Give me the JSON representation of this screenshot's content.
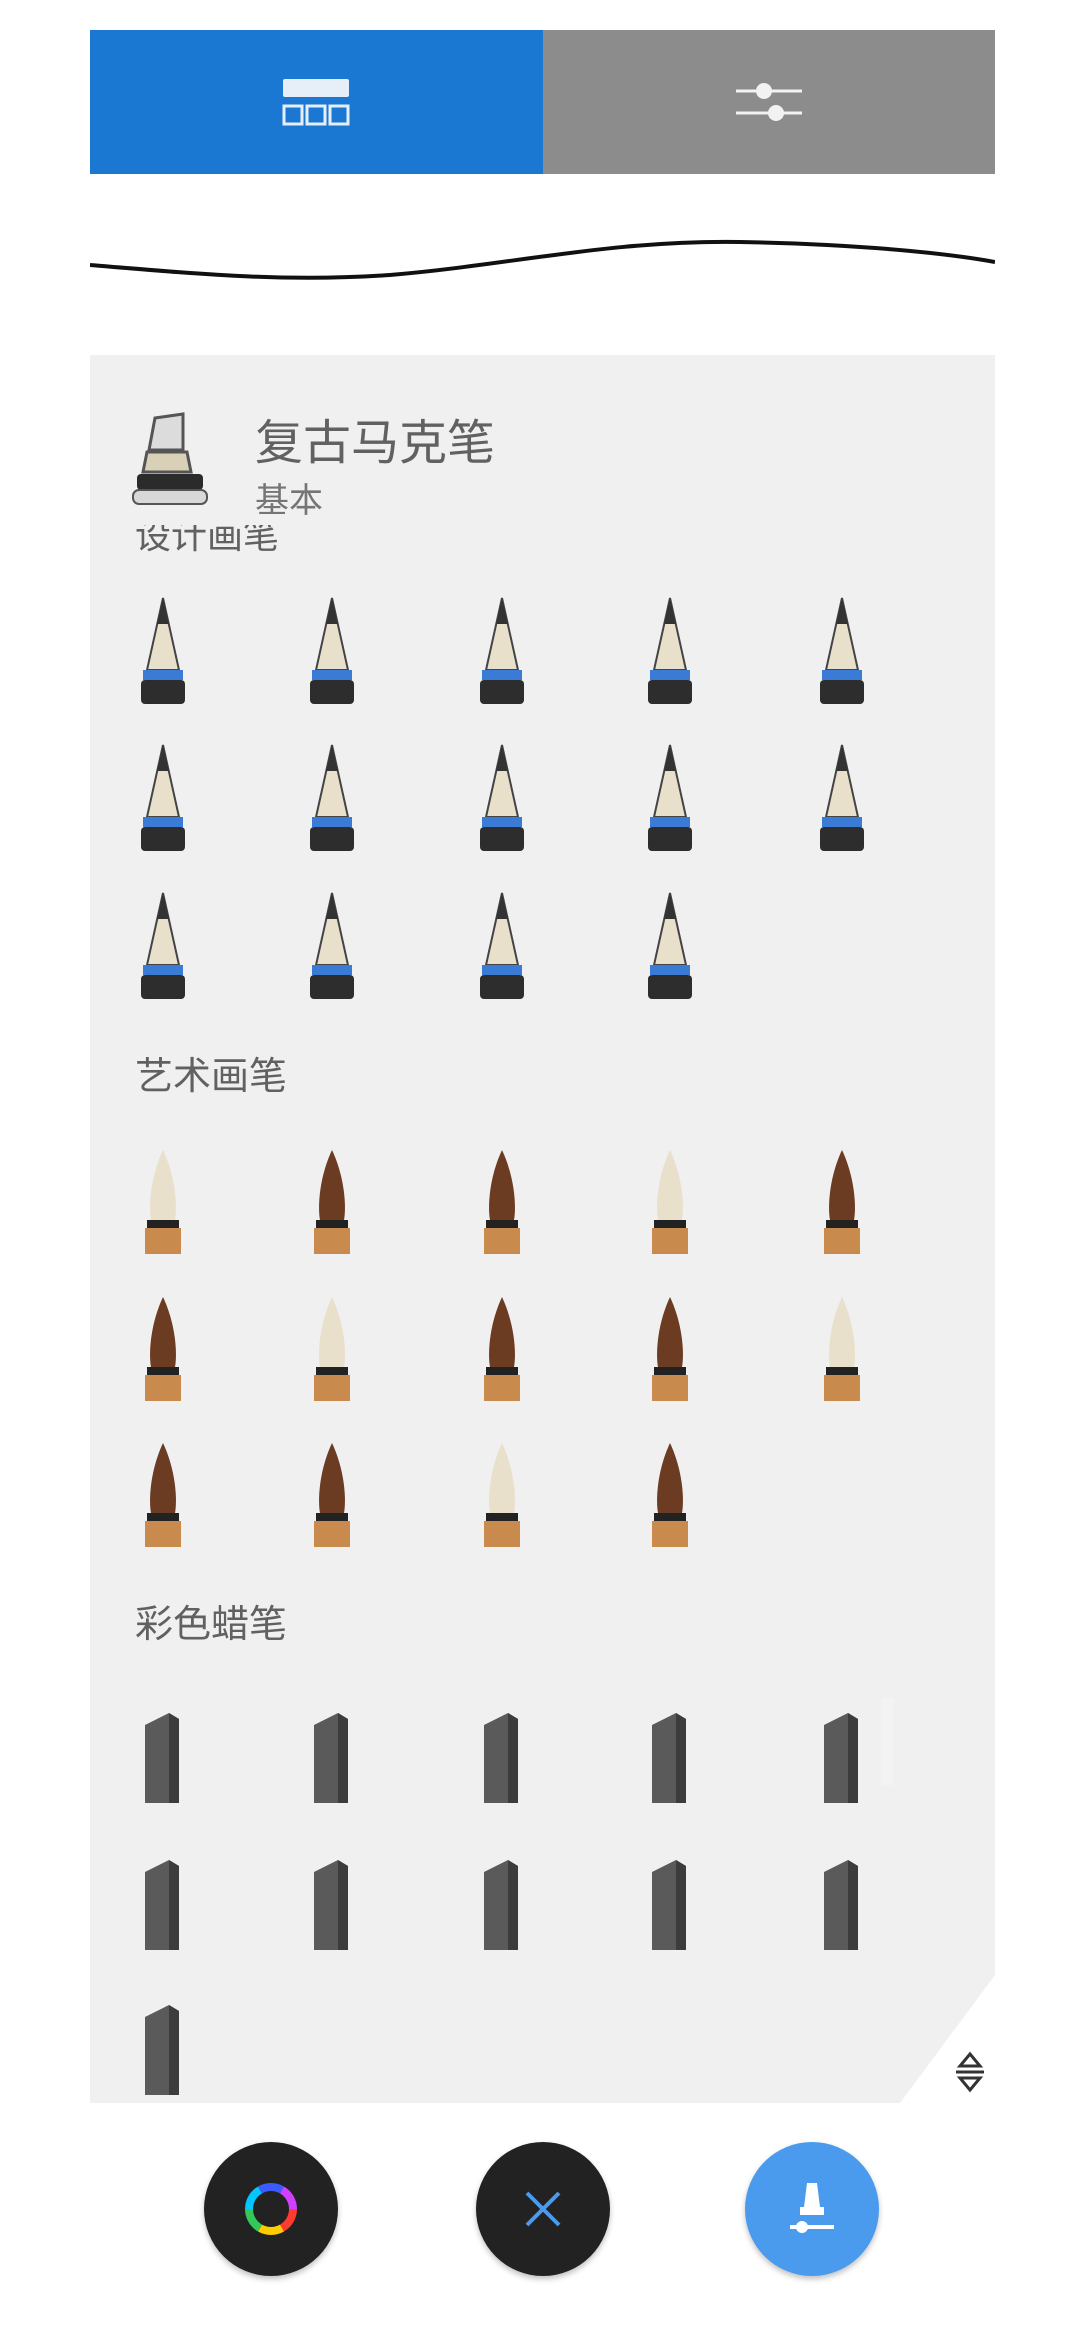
{
  "tabs": [
    {
      "name": "brush-library-icon",
      "selected": true
    },
    {
      "name": "brush-settings-icon",
      "selected": false
    }
  ],
  "colors": {
    "accent": "#1a77d2",
    "fab_brush": "#4a9bed",
    "fab_dark": "#222222"
  },
  "current_brush": {
    "name": "复古马克笔",
    "category": "基本"
  },
  "categories": [
    {
      "label": "设计画笔",
      "brush_count": 14
    },
    {
      "label": "艺术画笔",
      "brush_count": 14
    },
    {
      "label": "彩色蜡笔",
      "brush_count": 11
    }
  ],
  "bottom_buttons": [
    {
      "name": "color-wheel-icon"
    },
    {
      "name": "close-icon"
    },
    {
      "name": "brush-icon"
    }
  ]
}
